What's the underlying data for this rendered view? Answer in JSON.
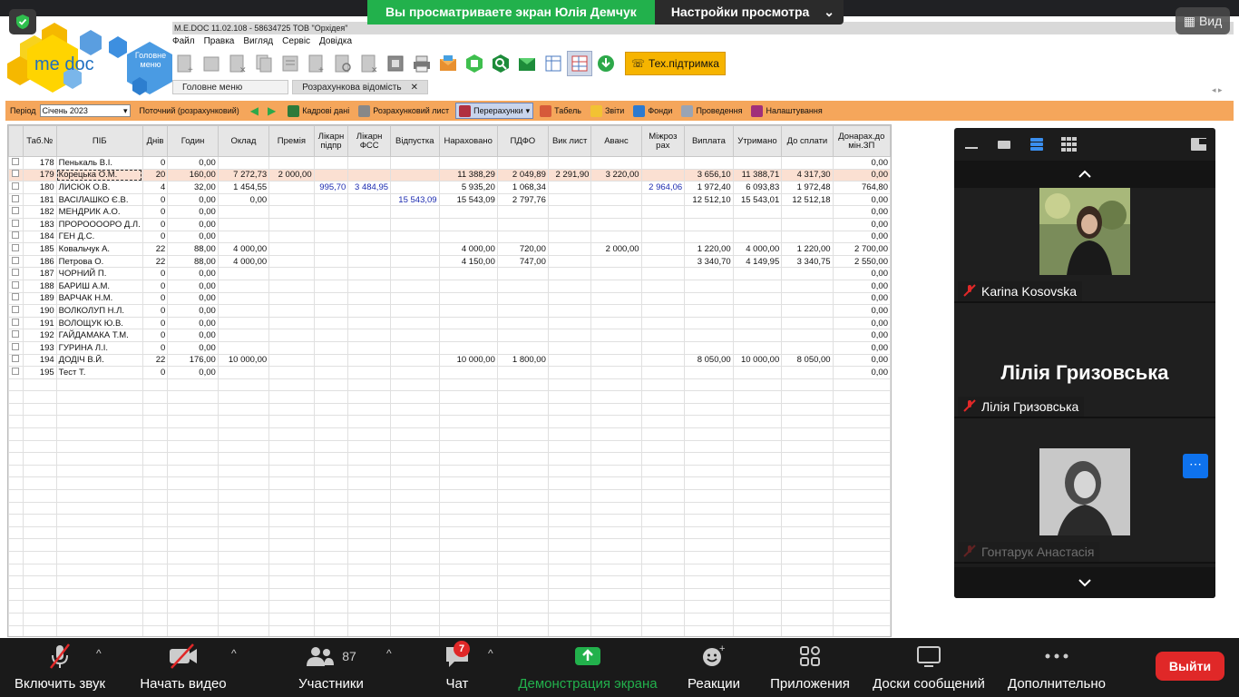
{
  "zoom": {
    "share_banner": "Вы просматриваете экран Юлія Демчук",
    "view_settings": "Настройки просмотра",
    "view_button": "Вид",
    "participants_count": "87",
    "chat_badge": "7",
    "controls": {
      "unmute": "Включить звук",
      "start_video": "Начать видео",
      "participants": "Участники",
      "chat": "Чат",
      "share": "Демонстрация экрана",
      "reactions": "Реакции",
      "apps": "Приложения",
      "whiteboards": "Доски сообщений",
      "more": "Дополнительно",
      "leave": "Выйти"
    },
    "participants": [
      {
        "name": "Karina Kosovska"
      },
      {
        "name": "Лілія Гризовська",
        "display": "Лілія Гризовська"
      },
      {
        "name": "Гонтарук Анастасія"
      }
    ]
  },
  "medoc": {
    "logo_text": "me doc",
    "logo_badge": "Головне меню",
    "window_title": "M.E.DOC 11.02.108 - 58634725 ТОВ \"Орхідея\"",
    "menu": [
      "Файл",
      "Правка",
      "Вигляд",
      "Сервіс",
      "Довідка"
    ],
    "tech_support": "Тех.підтримка",
    "tabs": [
      "Головне меню",
      "Розрахункова відомість"
    ],
    "filter": {
      "period_label": "Період",
      "period_value": "Січень 2023",
      "current": "Поточний (розрахунковий)",
      "buttons": [
        "Кадрові дані",
        "Розрахунковий лист",
        "Перерахунки",
        "Табель",
        "Звіти",
        "Фонди",
        "Проведення",
        "Налаштування"
      ]
    },
    "headers": [
      "",
      "Таб.№",
      "ПІБ",
      "Днів",
      "Годин",
      "Оклад",
      "Премія",
      "Лікарн підпр",
      "Лікарн ФСС",
      "Відпустка",
      "Нараховано",
      "ПДФО",
      "Вик лист",
      "Аванс",
      "Міжроз рах",
      "Виплата",
      "Утримано",
      "До сплати",
      "Донарах.до мін.ЗП"
    ],
    "rows": [
      [
        "178",
        "Пенькаль В.І.",
        "0",
        "0,00",
        "",
        "",
        "",
        "",
        "",
        "",
        "",
        "",
        "",
        "",
        "",
        "",
        "",
        "0,00"
      ],
      [
        "179",
        "Корецька О.М.",
        "20",
        "160,00",
        "7 272,73",
        "2 000,00",
        "",
        "",
        "",
        "11 388,29",
        "2 049,89",
        "2 291,90",
        "3 220,00",
        "",
        "3 656,10",
        "11 388,71",
        "4 317,30",
        "0,00"
      ],
      [
        "180",
        "ЛИСЮК О.В.",
        "4",
        "32,00",
        "1 454,55",
        "",
        "995,70",
        "3 484,95",
        "",
        "5 935,20",
        "1 068,34",
        "",
        "",
        "2 964,06",
        "1 972,40",
        "6 093,83",
        "1 972,48",
        "764,80"
      ],
      [
        "181",
        "ВАСІЛАШКО Є.В.",
        "0",
        "0,00",
        "0,00",
        "",
        "",
        "",
        "15 543,09",
        "15 543,09",
        "2 797,76",
        "",
        "",
        "",
        "12 512,10",
        "15 543,01",
        "12 512,18",
        "0,00"
      ],
      [
        "182",
        "МЕНДРИК А.О.",
        "0",
        "0,00",
        "",
        "",
        "",
        "",
        "",
        "",
        "",
        "",
        "",
        "",
        "",
        "",
        "",
        "0,00"
      ],
      [
        "183",
        "ПРОРООООРО Д.Л.",
        "0",
        "0,00",
        "",
        "",
        "",
        "",
        "",
        "",
        "",
        "",
        "",
        "",
        "",
        "",
        "",
        "0,00"
      ],
      [
        "184",
        "ГЕН Д.С.",
        "0",
        "0,00",
        "",
        "",
        "",
        "",
        "",
        "",
        "",
        "",
        "",
        "",
        "",
        "",
        "",
        "0,00"
      ],
      [
        "185",
        "Ковальчук А.",
        "22",
        "88,00",
        "4 000,00",
        "",
        "",
        "",
        "",
        "4 000,00",
        "720,00",
        "",
        "2 000,00",
        "",
        "1 220,00",
        "4 000,00",
        "1 220,00",
        "2 700,00"
      ],
      [
        "186",
        "Петрова О.",
        "22",
        "88,00",
        "4 000,00",
        "",
        "",
        "",
        "",
        "4 150,00",
        "747,00",
        "",
        "",
        "",
        "3 340,70",
        "4 149,95",
        "3 340,75",
        "2 550,00"
      ],
      [
        "187",
        "ЧОРНИЙ П.",
        "0",
        "0,00",
        "",
        "",
        "",
        "",
        "",
        "",
        "",
        "",
        "",
        "",
        "",
        "",
        "",
        "0,00"
      ],
      [
        "188",
        "БАРИШ А.М.",
        "0",
        "0,00",
        "",
        "",
        "",
        "",
        "",
        "",
        "",
        "",
        "",
        "",
        "",
        "",
        "",
        "0,00"
      ],
      [
        "189",
        "ВАРЧАК Н.М.",
        "0",
        "0,00",
        "",
        "",
        "",
        "",
        "",
        "",
        "",
        "",
        "",
        "",
        "",
        "",
        "",
        "0,00"
      ],
      [
        "190",
        "ВОЛКОЛУП Н.Л.",
        "0",
        "0,00",
        "",
        "",
        "",
        "",
        "",
        "",
        "",
        "",
        "",
        "",
        "",
        "",
        "",
        "0,00"
      ],
      [
        "191",
        "ВОЛОЩУК Ю.В.",
        "0",
        "0,00",
        "",
        "",
        "",
        "",
        "",
        "",
        "",
        "",
        "",
        "",
        "",
        "",
        "",
        "0,00"
      ],
      [
        "192",
        "ГАЙДАМАКА Т.М.",
        "0",
        "0,00",
        "",
        "",
        "",
        "",
        "",
        "",
        "",
        "",
        "",
        "",
        "",
        "",
        "",
        "0,00"
      ],
      [
        "193",
        "ГУРИНА Л.І.",
        "0",
        "0,00",
        "",
        "",
        "",
        "",
        "",
        "",
        "",
        "",
        "",
        "",
        "",
        "",
        "",
        "0,00"
      ],
      [
        "194",
        "ДОДІЧ В.Й.",
        "22",
        "176,00",
        "10 000,00",
        "",
        "",
        "",
        "",
        "10 000,00",
        "1 800,00",
        "",
        "",
        "",
        "8 050,00",
        "10 000,00",
        "8 050,00",
        "0,00"
      ],
      [
        "195",
        "Тест Т.",
        "0",
        "0,00",
        "",
        "",
        "",
        "",
        "",
        "",
        "",
        "",
        "",
        "",
        "",
        "",
        "",
        "0,00"
      ]
    ],
    "empty_rows": 21
  }
}
